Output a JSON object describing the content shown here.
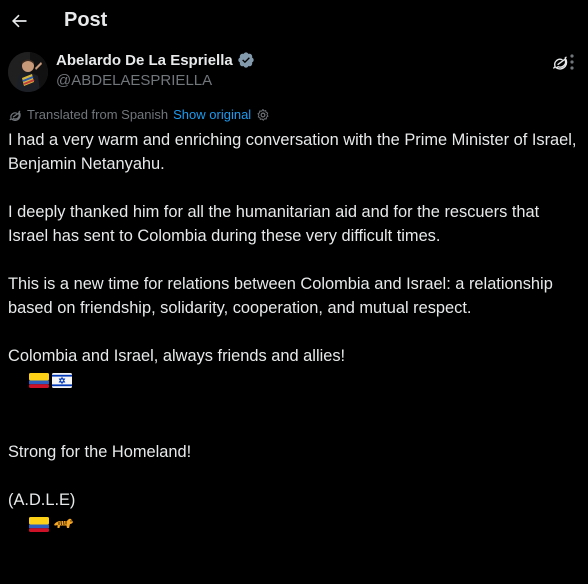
{
  "header": {
    "title": "Post",
    "back_icon": "arrow-left-icon"
  },
  "author": {
    "display_name": "Abelardo De La Espriella",
    "handle": "@ABDELAESPRIELLA",
    "verified": true,
    "verified_color": "#71767b"
  },
  "translation": {
    "label": "Translated from Spanish",
    "show_original": "Show original",
    "link_color": "#1d9bf0"
  },
  "post": {
    "paragraphs": [
      "I had a very warm and enriching conversation with the Prime Minister of Israel, Benjamin Netanyahu.",
      "I deeply thanked him for all the humanitarian aid and for the rescuers that Israel has sent to Colombia during these very difficult times.",
      "This is a new time for relations between Colombia and Israel: a relationship based on friendship, solidarity, cooperation, and mutual respect.",
      "Colombia and Israel, always friends and allies!",
      "Strong for the Homeland!",
      "(A.D.L.E)"
    ],
    "emojis": [
      "colombia-flag-icon",
      "israel-flag-icon",
      "colombia-flag-icon",
      "tiger-icon"
    ]
  },
  "colors": {
    "background": "#000000",
    "text": "#e7e9ea",
    "secondary": "#71767b",
    "accent": "#1d9bf0"
  }
}
